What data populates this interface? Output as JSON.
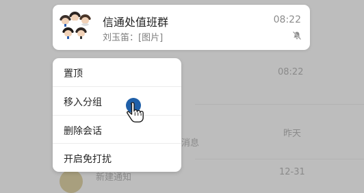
{
  "background_list": {
    "rows": [
      {
        "time": "08:22",
        "text": ""
      },
      {
        "time": "昨天",
        "text": "消息"
      },
      {
        "time": "12-31",
        "text": "新建通知"
      }
    ]
  },
  "chat": {
    "title": "信通处值班群",
    "subtitle": "刘玉笛：[图片]",
    "time": "08:22",
    "muted": true,
    "avatar_icon": "group-avatar",
    "mute_icon": "bell-off-icon"
  },
  "context_menu": {
    "items": [
      {
        "label": "置顶"
      },
      {
        "label": "移入分组"
      },
      {
        "label": "删除会话"
      },
      {
        "label": "开启免打扰"
      }
    ]
  },
  "cursor": {
    "icon": "hand-pointer-icon"
  },
  "colors": {
    "overlay": "#bdbdbd",
    "card": "#ffffff",
    "title": "#202020",
    "secondary": "#8c8c8c"
  }
}
